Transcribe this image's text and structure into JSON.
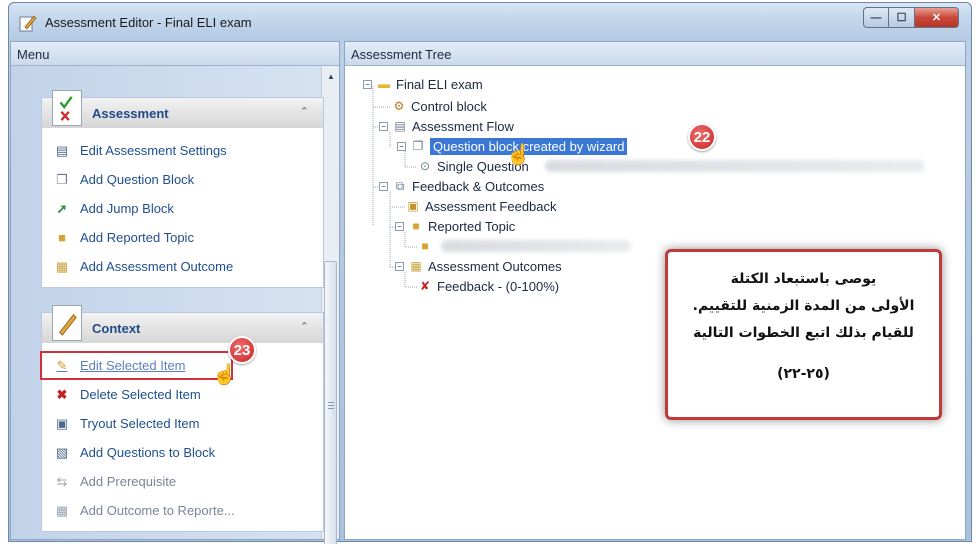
{
  "window": {
    "title": "Assessment Editor - Final ELI exam",
    "buttons": {
      "minimize": "—",
      "maximize": "☐",
      "close": "✕"
    }
  },
  "menu": {
    "header": "Menu",
    "groups": [
      {
        "label": "Assessment",
        "chevron": "⌃",
        "items": [
          {
            "label": "Edit Assessment Settings",
            "icon": "settings-doc-icon"
          },
          {
            "label": "Add Question Block",
            "icon": "question-block-icon"
          },
          {
            "label": "Add Jump Block",
            "icon": "jump-arrow-icon"
          },
          {
            "label": "Add Reported Topic",
            "icon": "topic-folder-icon"
          },
          {
            "label": "Add Assessment Outcome",
            "icon": "outcome-icon"
          }
        ]
      },
      {
        "label": "Context",
        "chevron": "⌃",
        "items": [
          {
            "label": "Edit Selected Item",
            "icon": "pencil-icon"
          },
          {
            "label": "Delete Selected Item",
            "icon": "delete-x-icon"
          },
          {
            "label": "Tryout Selected Item",
            "icon": "tryout-icon"
          },
          {
            "label": "Add Questions to Block",
            "icon": "add-questions-icon"
          },
          {
            "label": "Add Prerequisite",
            "icon": "prerequisite-icon"
          },
          {
            "label": "Add Outcome to Reporte...",
            "icon": "add-outcome-icon"
          }
        ]
      }
    ]
  },
  "tree": {
    "header": "Assessment Tree",
    "nodes": {
      "root": "Final ELI exam",
      "control": "Control block",
      "flow": "Assessment Flow",
      "question_block": "Question block created by wizard",
      "single_question": "Single Question",
      "feedback_outcomes": "Feedback & Outcomes",
      "assessment_feedback": "Assessment Feedback",
      "reported_topic": "Reported Topic",
      "assessment_outcomes": "Assessment Outcomes",
      "feedback_range": "Feedback - (0-100%)"
    }
  },
  "annotations": {
    "badge_22": "22",
    "badge_23": "23",
    "callout": {
      "line1": "يوصى باستبعاد الكتلة",
      "line2": "الأولى من المدة الزمنية للتقييم.",
      "line3": "للقيام بذلك اتبع الخطوات التالية",
      "line4": "(٢٥-٢٢)"
    }
  },
  "colors": {
    "accent": "#3b78d6",
    "badge": "#c72727",
    "callout_border": "#c0393b",
    "link_text": "#1f4f8f"
  }
}
